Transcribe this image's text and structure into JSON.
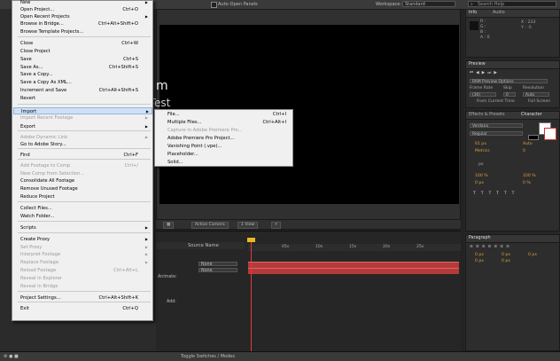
{
  "topbar": {
    "auto_open_panels": "Auto-Open Panels",
    "workspace_label": "Workspace:",
    "workspace_value": "Standard",
    "search_help_placeholder": "Search Help"
  },
  "composition": {
    "text_line1": "m",
    "text_line2": "ects Test"
  },
  "viewer_toolbar": {
    "camera": "Active Camera",
    "view": "1 View"
  },
  "timeline": {
    "ticks": [
      "0s",
      "05s",
      "10s",
      "15s",
      "20s",
      "25s"
    ],
    "source_name_header": "Source Name",
    "mode_none_1": "None",
    "mode_none_2": "None",
    "animate_label": "Animate:",
    "add_label": "Add:",
    "toggle_label": "Toggle Switches / Modes"
  },
  "info_panel": {
    "tabs": [
      "Info",
      "Audio"
    ],
    "r": "R :",
    "g": "G :",
    "b": "B :",
    "a": "A : 0",
    "x": "X : 233",
    "y": "Y : -5"
  },
  "preview_panel": {
    "tab": "Preview",
    "ram_options": "RAM Preview Options",
    "frame_rate_label": "Frame Rate",
    "skip_label": "Skip",
    "resolution_label": "Resolution",
    "frame_rate_value": "(30)",
    "skip_value": "0",
    "resolution_value": "Auto",
    "from_current_time": "From Current Time",
    "full_screen": "Full Screen"
  },
  "character_panel": {
    "tabs": [
      "Effects & Presets",
      "Character"
    ],
    "font": "Verdana",
    "style": "Regular",
    "size": "61 px",
    "leading": "Auto",
    "tracking": "Metrics",
    "kerning": "0",
    "stroke": "px",
    "vscale": "100 %",
    "hscale": "100 %",
    "baseline": "0 px",
    "tsume": "0 %"
  },
  "paragraph_panel": {
    "tabs": [
      "Paragraph"
    ],
    "indent1": "0 px",
    "indent2": "0 px",
    "indent3": "0 px",
    "space1": "0 px",
    "space2": "0 px"
  },
  "file_menu": {
    "items": [
      {
        "label": "New",
        "shortcut": "",
        "arrow": true,
        "disabled": false
      },
      {
        "label": "Open Project...",
        "shortcut": "Ctrl+O",
        "arrow": false,
        "disabled": false
      },
      {
        "label": "Open Recent Projects",
        "shortcut": "",
        "arrow": true,
        "disabled": false
      },
      {
        "label": "Browse in Bridge...",
        "shortcut": "Ctrl+Alt+Shift+O",
        "arrow": false,
        "disabled": false
      },
      {
        "label": "Browse Template Projects...",
        "shortcut": "",
        "arrow": false,
        "disabled": false
      },
      {
        "label": "Close",
        "shortcut": "Ctrl+W",
        "arrow": false,
        "disabled": false
      },
      {
        "label": "Close Project",
        "shortcut": "",
        "arrow": false,
        "disabled": false
      },
      {
        "label": "Save",
        "shortcut": "Ctrl+S",
        "arrow": false,
        "disabled": false
      },
      {
        "label": "Save As...",
        "shortcut": "Ctrl+Shift+S",
        "arrow": false,
        "disabled": false
      },
      {
        "label": "Save a Copy...",
        "shortcut": "",
        "arrow": false,
        "disabled": false
      },
      {
        "label": "Save a Copy As XML...",
        "shortcut": "",
        "arrow": false,
        "disabled": false
      },
      {
        "label": "Increment and Save",
        "shortcut": "Ctrl+Alt+Shift+S",
        "arrow": false,
        "disabled": false
      },
      {
        "label": "Revert",
        "shortcut": "",
        "arrow": false,
        "disabled": false
      },
      {
        "label": "Import",
        "shortcut": "",
        "arrow": true,
        "disabled": false
      },
      {
        "label": "Import Recent Footage",
        "shortcut": "",
        "arrow": true,
        "disabled": true
      },
      {
        "label": "Export",
        "shortcut": "",
        "arrow": true,
        "disabled": false
      },
      {
        "label": "Adobe Dynamic Link",
        "shortcut": "",
        "arrow": true,
        "disabled": true
      },
      {
        "label": "Go to Adobe Story...",
        "shortcut": "",
        "arrow": false,
        "disabled": false
      },
      {
        "label": "Find",
        "shortcut": "Ctrl+F",
        "arrow": false,
        "disabled": false
      },
      {
        "label": "Add Footage to Comp",
        "shortcut": "Ctrl+/",
        "arrow": false,
        "disabled": true
      },
      {
        "label": "New Comp from Selection...",
        "shortcut": "",
        "arrow": false,
        "disabled": true
      },
      {
        "label": "Consolidate All Footage",
        "shortcut": "",
        "arrow": false,
        "disabled": false
      },
      {
        "label": "Remove Unused Footage",
        "shortcut": "",
        "arrow": false,
        "disabled": false
      },
      {
        "label": "Reduce Project",
        "shortcut": "",
        "arrow": false,
        "disabled": false
      },
      {
        "label": "Collect Files...",
        "shortcut": "",
        "arrow": false,
        "disabled": false
      },
      {
        "label": "Watch Folder...",
        "shortcut": "",
        "arrow": false,
        "disabled": false
      },
      {
        "label": "Scripts",
        "shortcut": "",
        "arrow": true,
        "disabled": false
      },
      {
        "label": "Create Proxy",
        "shortcut": "",
        "arrow": true,
        "disabled": false
      },
      {
        "label": "Set Proxy",
        "shortcut": "",
        "arrow": true,
        "disabled": true
      },
      {
        "label": "Interpret Footage",
        "shortcut": "",
        "arrow": true,
        "disabled": true
      },
      {
        "label": "Replace Footage",
        "shortcut": "",
        "arrow": true,
        "disabled": true
      },
      {
        "label": "Reload Footage",
        "shortcut": "Ctrl+Alt+L",
        "arrow": false,
        "disabled": true
      },
      {
        "label": "Reveal in Explorer",
        "shortcut": "",
        "arrow": false,
        "disabled": true
      },
      {
        "label": "Reveal in Bridge",
        "shortcut": "",
        "arrow": false,
        "disabled": true
      },
      {
        "label": "Project Settings...",
        "shortcut": "Ctrl+Alt+Shift+K",
        "arrow": false,
        "disabled": false
      },
      {
        "label": "Exit",
        "shortcut": "Ctrl+Q",
        "arrow": false,
        "disabled": false
      }
    ]
  },
  "import_submenu": {
    "items": [
      {
        "label": "File...",
        "shortcut": "Ctrl+I",
        "disabled": false
      },
      {
        "label": "Multiple Files...",
        "shortcut": "Ctrl+Alt+I",
        "disabled": false
      },
      {
        "label": "Capture in Adobe Premiere Pro...",
        "shortcut": "",
        "disabled": true
      },
      {
        "label": "Adobe Premiere Pro Project...",
        "shortcut": "",
        "disabled": false
      },
      {
        "label": "Vanishing Point (.vpe)...",
        "shortcut": "",
        "disabled": false
      },
      {
        "label": "Placeholder...",
        "shortcut": "",
        "disabled": false
      },
      {
        "label": "Solid...",
        "shortcut": "",
        "disabled": false
      }
    ]
  },
  "colors": {
    "menu_bg": "#f0f0f0",
    "menu_highlight": "#cfe0f6",
    "playhead": "#e23b3b",
    "layer_bar": "#b53a3a",
    "ui_bg": "#232323"
  }
}
